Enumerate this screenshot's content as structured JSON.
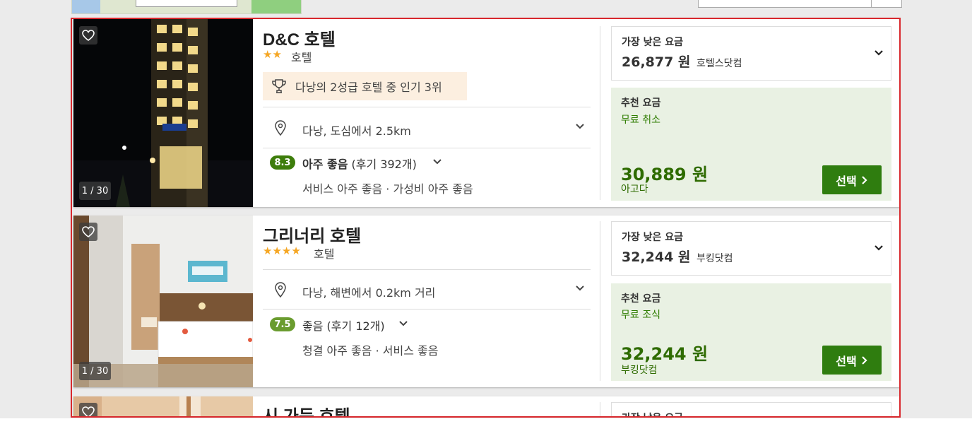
{
  "colors": {
    "highlight_border": "#d8282d",
    "score_green_dark": "#3d7d0b",
    "score_green_light": "#6a9c2f",
    "select_green": "#2f7d0f",
    "price_green": "#2e6b00",
    "star": "#f5a623"
  },
  "hotels": [
    {
      "name": "D&C 호텔",
      "stars": "★★",
      "type": "호텔",
      "award": "다낭의 2성급 호텔 중 인기 3위",
      "location": "다낭, 도심에서 2.5km",
      "score": "8.3",
      "score_word": "아주 좋음",
      "reviews": "(후기 392개)",
      "subscores": "서비스 아주 좋음 · 가성비 아주 좋음",
      "photo_counter": "1 / 30",
      "lowest_label": "가장 낮은 요금",
      "lowest_price": "26,877 원",
      "lowest_provider": "호텔스닷컴",
      "rec_label": "추천 요금",
      "rec_perk": "무료 취소",
      "rec_price": "30,889 원",
      "rec_provider": "아고다",
      "select_label": "선택"
    },
    {
      "name": "그리너리 호텔",
      "stars": "★★★★",
      "type": "호텔",
      "location": "다낭, 해변에서 0.2km 거리",
      "score": "7.5",
      "score_word": "좋음",
      "reviews": "(후기 12개)",
      "subscores": "청결 아주 좋음 · 서비스 좋음",
      "photo_counter": "1 / 30",
      "lowest_label": "가장 낮은 요금",
      "lowest_price": "32,244 원",
      "lowest_provider": "부킹닷컴",
      "rec_label": "추천 요금",
      "rec_perk": "무료 조식",
      "rec_price": "32,244 원",
      "rec_provider": "부킹닷컴",
      "select_label": "선택"
    },
    {
      "name": "시 가든 호텔",
      "lowest_label": "가장 낮은 요금"
    }
  ]
}
